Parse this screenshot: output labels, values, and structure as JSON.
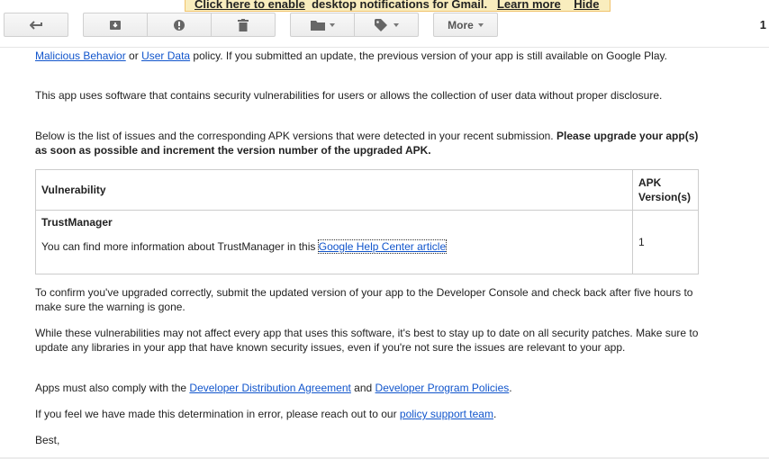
{
  "notice": {
    "enable_link": "Click here to enable",
    "text": "desktop notifications for Gmail.",
    "learn_more": "Learn more",
    "hide": "Hide"
  },
  "toolbar": {
    "more_label": "More",
    "page_indicator": "1"
  },
  "email": {
    "p1_link1": "Malicious Behavior",
    "p1_or": " or ",
    "p1_link2": "User Data",
    "p1_rest": " policy. If you submitted an update, the previous version of your app is still available on Google Play.",
    "p2": "This app uses software that contains security vulnerabilities for users or allows the collection of user data without proper disclosure.",
    "p3_start": "Below is the list of issues and the corresponding APK versions that were detected in your recent submission. ",
    "p3_bold": "Please upgrade your app(s) as soon as possible and increment the version number of the upgraded APK.",
    "table": {
      "col1_header": "Vulnerability",
      "col2_header_line1": "APK",
      "col2_header_line2": "Version(s)",
      "row_title": "TrustManager",
      "row_text": "You can find more information about TrustManager in this ",
      "row_link": "Google Help Center article",
      "row_version": "1"
    },
    "p4": "To confirm you've upgraded correctly, submit the updated version of your app to the Developer Console and check back after five hours to make sure the warning is gone.",
    "p5": "While these vulnerabilities may not affect every app that uses this software, it's best to stay up to date on all security patches. Make sure to update any libraries in your app that have known security issues, even if you're not sure the issues are relevant to your app.",
    "p6_start": "Apps must also comply with the ",
    "p6_link1": "Developer Distribution Agreement",
    "p6_and": " and ",
    "p6_link2": "Developer Program Policies",
    "p6_end": ".",
    "p7_start": "If you feel we have made this determination in error, please reach out to our ",
    "p7_link": "policy support team",
    "p7_end": ".",
    "signoff": "Best,"
  }
}
